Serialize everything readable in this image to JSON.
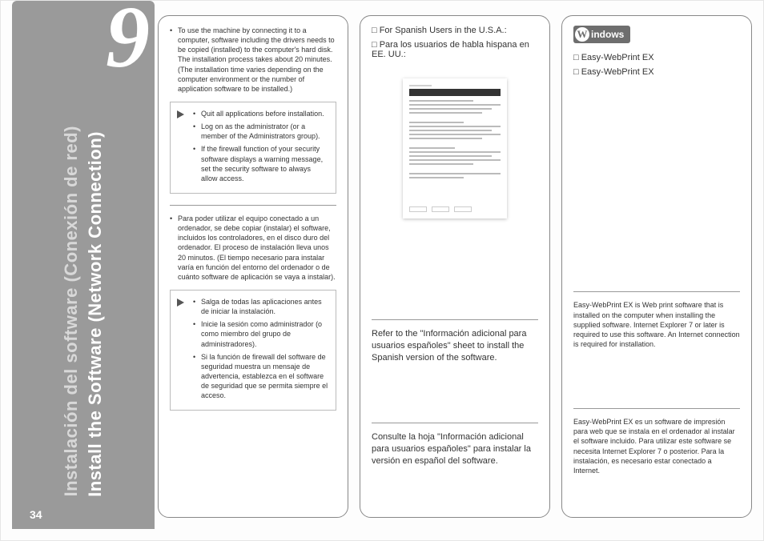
{
  "page_number": "34",
  "section_number": "9",
  "title_en": "Install the Software (Network Connection)",
  "title_es": "Instalación del software (Conexión de red)",
  "col1": {
    "intro_en": "To use the machine by connecting it to a computer, software including the drivers needs to be copied (installed) to the computer's hard disk. The installation process takes about 20 minutes. (The installation time varies depending on the computer environment or the number of application software to be installed.)",
    "tips_en": [
      "Quit all applications before installation.",
      "Log on as the administrator (or a member of the Administrators group).",
      "If the firewall function of your security software displays a warning message, set the security software to always allow access."
    ],
    "intro_es": "Para poder utilizar el equipo conectado a un ordenador, se debe copiar (instalar) el software, incluidos los controladores, en el disco duro del ordenador. El proceso de instalación lleva unos 20 minutos. (El tiempo necesario para instalar varía en función del entorno del ordenador o de cuánto software de aplicación se vaya a instalar).",
    "tips_es": [
      "Salga de todas las aplicaciones antes de iniciar la instalación.",
      "Inicie la sesión como administrador (o como miembro del grupo de administradores).",
      "Si la función de firewall del software de seguridad muestra un mensaje de advertencia, establezca en el software de seguridad que se permita siempre el acceso."
    ]
  },
  "col2": {
    "heading_en": "□ For Spanish Users in the U.S.A.:",
    "heading_es": "□ Para los usuarios de habla hispana en EE. UU.:",
    "refer_en": "Refer to the \"Información adicional para usuarios españoles\" sheet to install the Spanish version of the software.",
    "refer_es": "Consulte la hoja \"Información adicional para usuarios españoles\" para instalar la versión en español del software."
  },
  "col3": {
    "badge": "indows",
    "item1": "□ Easy-WebPrint EX",
    "item2": "□ Easy-WebPrint EX",
    "note_en": "Easy-WebPrint EX is Web print software that is installed on the computer when installing the supplied software. Internet Explorer 7 or later is required to use this software. An Internet connection is required for installation.",
    "note_es": "Easy-WebPrint EX es un software de impresión para web que se instala en el ordenador al instalar el software incluido. Para utilizar este software se necesita Internet Explorer 7 o posterior. Para la instalación, es necesario estar conectado a Internet."
  }
}
